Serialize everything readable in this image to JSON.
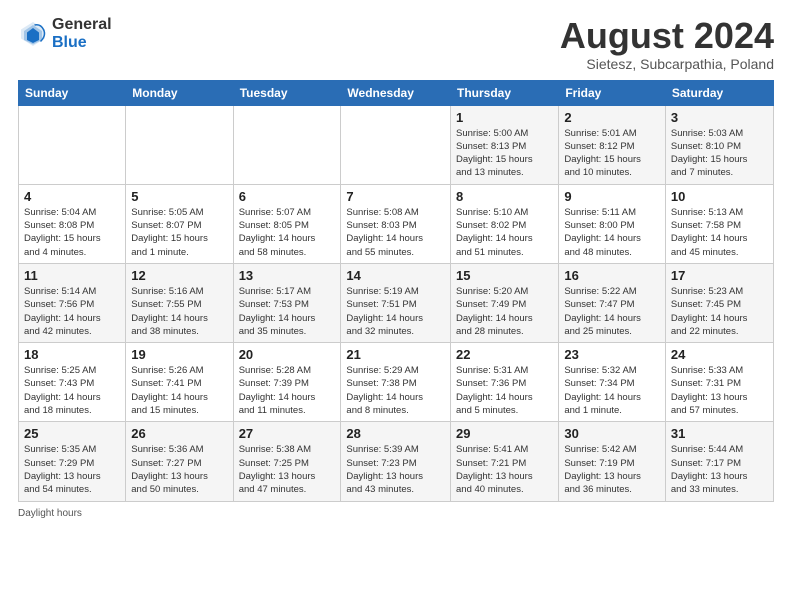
{
  "header": {
    "logo_line1": "General",
    "logo_line2": "Blue",
    "main_title": "August 2024",
    "subtitle": "Sietesz, Subcarpathia, Poland"
  },
  "calendar": {
    "headers": [
      "Sunday",
      "Monday",
      "Tuesday",
      "Wednesday",
      "Thursday",
      "Friday",
      "Saturday"
    ],
    "weeks": [
      [
        {
          "day": "",
          "info": ""
        },
        {
          "day": "",
          "info": ""
        },
        {
          "day": "",
          "info": ""
        },
        {
          "day": "",
          "info": ""
        },
        {
          "day": "1",
          "info": "Sunrise: 5:00 AM\nSunset: 8:13 PM\nDaylight: 15 hours\nand 13 minutes."
        },
        {
          "day": "2",
          "info": "Sunrise: 5:01 AM\nSunset: 8:12 PM\nDaylight: 15 hours\nand 10 minutes."
        },
        {
          "day": "3",
          "info": "Sunrise: 5:03 AM\nSunset: 8:10 PM\nDaylight: 15 hours\nand 7 minutes."
        }
      ],
      [
        {
          "day": "4",
          "info": "Sunrise: 5:04 AM\nSunset: 8:08 PM\nDaylight: 15 hours\nand 4 minutes."
        },
        {
          "day": "5",
          "info": "Sunrise: 5:05 AM\nSunset: 8:07 PM\nDaylight: 15 hours\nand 1 minute."
        },
        {
          "day": "6",
          "info": "Sunrise: 5:07 AM\nSunset: 8:05 PM\nDaylight: 14 hours\nand 58 minutes."
        },
        {
          "day": "7",
          "info": "Sunrise: 5:08 AM\nSunset: 8:03 PM\nDaylight: 14 hours\nand 55 minutes."
        },
        {
          "day": "8",
          "info": "Sunrise: 5:10 AM\nSunset: 8:02 PM\nDaylight: 14 hours\nand 51 minutes."
        },
        {
          "day": "9",
          "info": "Sunrise: 5:11 AM\nSunset: 8:00 PM\nDaylight: 14 hours\nand 48 minutes."
        },
        {
          "day": "10",
          "info": "Sunrise: 5:13 AM\nSunset: 7:58 PM\nDaylight: 14 hours\nand 45 minutes."
        }
      ],
      [
        {
          "day": "11",
          "info": "Sunrise: 5:14 AM\nSunset: 7:56 PM\nDaylight: 14 hours\nand 42 minutes."
        },
        {
          "day": "12",
          "info": "Sunrise: 5:16 AM\nSunset: 7:55 PM\nDaylight: 14 hours\nand 38 minutes."
        },
        {
          "day": "13",
          "info": "Sunrise: 5:17 AM\nSunset: 7:53 PM\nDaylight: 14 hours\nand 35 minutes."
        },
        {
          "day": "14",
          "info": "Sunrise: 5:19 AM\nSunset: 7:51 PM\nDaylight: 14 hours\nand 32 minutes."
        },
        {
          "day": "15",
          "info": "Sunrise: 5:20 AM\nSunset: 7:49 PM\nDaylight: 14 hours\nand 28 minutes."
        },
        {
          "day": "16",
          "info": "Sunrise: 5:22 AM\nSunset: 7:47 PM\nDaylight: 14 hours\nand 25 minutes."
        },
        {
          "day": "17",
          "info": "Sunrise: 5:23 AM\nSunset: 7:45 PM\nDaylight: 14 hours\nand 22 minutes."
        }
      ],
      [
        {
          "day": "18",
          "info": "Sunrise: 5:25 AM\nSunset: 7:43 PM\nDaylight: 14 hours\nand 18 minutes."
        },
        {
          "day": "19",
          "info": "Sunrise: 5:26 AM\nSunset: 7:41 PM\nDaylight: 14 hours\nand 15 minutes."
        },
        {
          "day": "20",
          "info": "Sunrise: 5:28 AM\nSunset: 7:39 PM\nDaylight: 14 hours\nand 11 minutes."
        },
        {
          "day": "21",
          "info": "Sunrise: 5:29 AM\nSunset: 7:38 PM\nDaylight: 14 hours\nand 8 minutes."
        },
        {
          "day": "22",
          "info": "Sunrise: 5:31 AM\nSunset: 7:36 PM\nDaylight: 14 hours\nand 5 minutes."
        },
        {
          "day": "23",
          "info": "Sunrise: 5:32 AM\nSunset: 7:34 PM\nDaylight: 14 hours\nand 1 minute."
        },
        {
          "day": "24",
          "info": "Sunrise: 5:33 AM\nSunset: 7:31 PM\nDaylight: 13 hours\nand 57 minutes."
        }
      ],
      [
        {
          "day": "25",
          "info": "Sunrise: 5:35 AM\nSunset: 7:29 PM\nDaylight: 13 hours\nand 54 minutes."
        },
        {
          "day": "26",
          "info": "Sunrise: 5:36 AM\nSunset: 7:27 PM\nDaylight: 13 hours\nand 50 minutes."
        },
        {
          "day": "27",
          "info": "Sunrise: 5:38 AM\nSunset: 7:25 PM\nDaylight: 13 hours\nand 47 minutes."
        },
        {
          "day": "28",
          "info": "Sunrise: 5:39 AM\nSunset: 7:23 PM\nDaylight: 13 hours\nand 43 minutes."
        },
        {
          "day": "29",
          "info": "Sunrise: 5:41 AM\nSunset: 7:21 PM\nDaylight: 13 hours\nand 40 minutes."
        },
        {
          "day": "30",
          "info": "Sunrise: 5:42 AM\nSunset: 7:19 PM\nDaylight: 13 hours\nand 36 minutes."
        },
        {
          "day": "31",
          "info": "Sunrise: 5:44 AM\nSunset: 7:17 PM\nDaylight: 13 hours\nand 33 minutes."
        }
      ]
    ]
  },
  "footer": {
    "note": "Daylight hours"
  }
}
